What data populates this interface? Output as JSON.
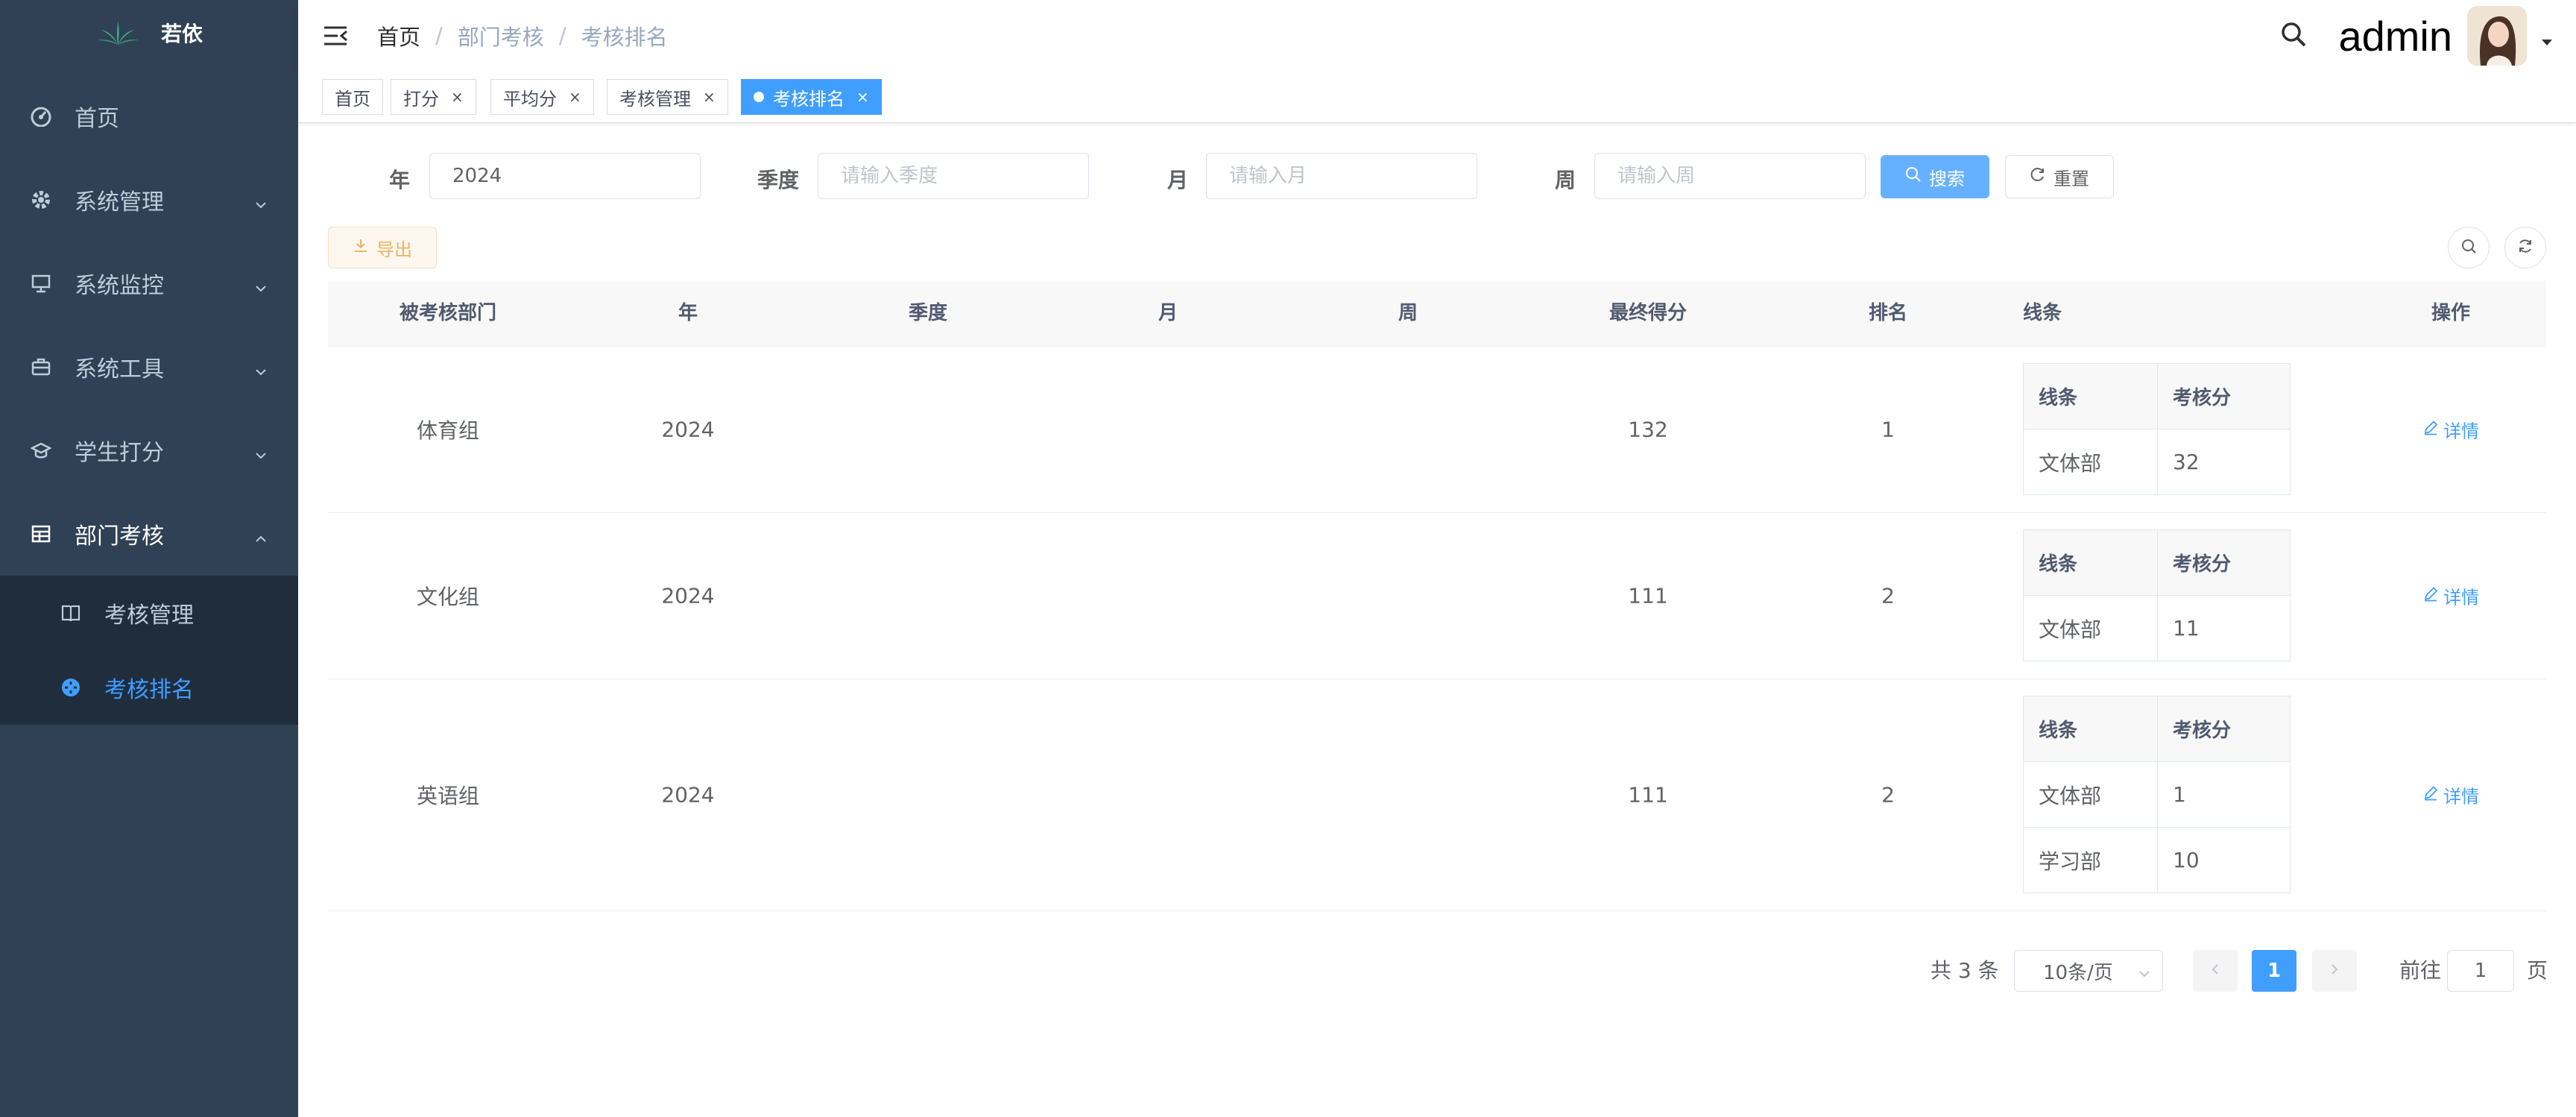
{
  "app": {
    "title": "若依"
  },
  "sidebar": {
    "items": [
      {
        "label": "首页",
        "icon": "dashboard-icon"
      },
      {
        "label": "系统管理",
        "icon": "system-icon"
      },
      {
        "label": "系统监控",
        "icon": "monitor-icon"
      },
      {
        "label": "系统工具",
        "icon": "tool-icon"
      },
      {
        "label": "学生打分",
        "icon": "education-icon"
      },
      {
        "label": "部门考核",
        "icon": "table-icon",
        "expanded": true
      }
    ],
    "submenu": [
      {
        "label": "考核管理",
        "icon": "book-icon"
      },
      {
        "label": "考核排名",
        "icon": "ranking-icon",
        "active": true
      }
    ],
    "colors": {
      "background": "#304156",
      "active": "#409eff",
      "text": "#bfcbd9"
    }
  },
  "navbar": {
    "breadcrumb": [
      "首页",
      "部门考核",
      "考核排名"
    ],
    "username": "admin"
  },
  "tags": [
    {
      "label": "首页",
      "closable": false
    },
    {
      "label": "打分",
      "closable": true
    },
    {
      "label": "平均分",
      "closable": true
    },
    {
      "label": "考核管理",
      "closable": true
    },
    {
      "label": "考核排名",
      "closable": true,
      "active": true
    }
  ],
  "search": {
    "year_label": "年",
    "year_value": "2024",
    "quarter_label": "季度",
    "quarter_placeholder": "请输入季度",
    "month_label": "月",
    "month_placeholder": "请输入月",
    "week_label": "周",
    "week_placeholder": "请输入周",
    "search_button": "搜索",
    "reset_button": "重置"
  },
  "toolbar": {
    "export_button": "导出"
  },
  "table": {
    "columns": [
      "被考核部门",
      "年",
      "季度",
      "月",
      "周",
      "最终得分",
      "排名",
      "线条",
      "操作"
    ],
    "inner_columns": [
      "线条",
      "考核分"
    ],
    "action_label": "详情",
    "rows": [
      {
        "dept": "体育组",
        "year": "2024",
        "quarter": "",
        "month": "",
        "week": "",
        "score": "132",
        "rank": "1",
        "lines": [
          {
            "line": "文体部",
            "score": "32"
          }
        ]
      },
      {
        "dept": "文化组",
        "year": "2024",
        "quarter": "",
        "month": "",
        "week": "",
        "score": "111",
        "rank": "2",
        "lines": [
          {
            "line": "文体部",
            "score": "11"
          }
        ]
      },
      {
        "dept": "英语组",
        "year": "2024",
        "quarter": "",
        "month": "",
        "week": "",
        "score": "111",
        "rank": "2",
        "lines": [
          {
            "line": "文体部",
            "score": "1"
          },
          {
            "line": "学习部",
            "score": "10"
          }
        ]
      }
    ]
  },
  "pagination": {
    "total": "共 3 条",
    "page_size": "10条/页",
    "current_page": "1",
    "goto_label": "前往",
    "goto_value": "1",
    "goto_suffix": "页"
  }
}
